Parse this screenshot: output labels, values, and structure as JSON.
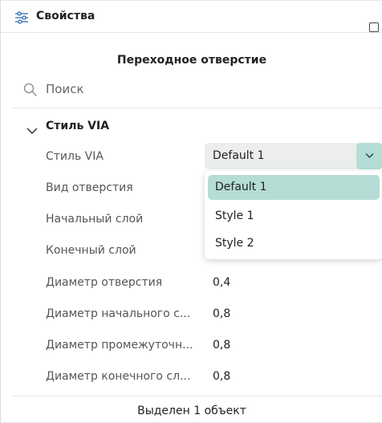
{
  "panel": {
    "title": "Свойства",
    "subtitle": "Переходное отверстие"
  },
  "search": {
    "placeholder": "Поиск"
  },
  "group": {
    "label": "Стиль VIA",
    "expanded": true
  },
  "properties": [
    {
      "label": "Стиль VIA",
      "value": "Default 1"
    },
    {
      "label": "Вид отверстия",
      "value": ""
    },
    {
      "label": "Начальный слой",
      "value": ""
    },
    {
      "label": "Конечный слой",
      "value": ""
    },
    {
      "label": "Диаметр отверстия",
      "value": "0,4"
    },
    {
      "label": "Диаметр начального с...",
      "value": "0,8"
    },
    {
      "label": "Диаметр промежуточн...",
      "value": "0,8"
    },
    {
      "label": "Диаметр конечного сл...",
      "value": "0,8"
    }
  ],
  "select": {
    "value": "Default 1"
  },
  "dropdown": {
    "options": [
      "Default 1",
      "Style 1",
      "Style 2"
    ],
    "selected": "Default 1"
  },
  "footer": {
    "status": "Выделен 1 объект"
  },
  "colors": {
    "accent": "#b5ddd5",
    "select_bg": "#ebeeec"
  }
}
